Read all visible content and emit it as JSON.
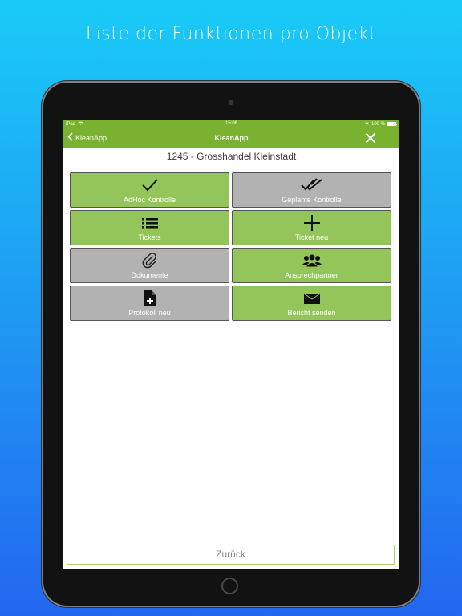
{
  "headline": "Liste der Funktionen pro Objekt",
  "status": {
    "device": "iPad",
    "time": "15:08",
    "battery": "100 %",
    "battery_level": 1.0
  },
  "nav": {
    "back_label": "KleanApp",
    "title": "KleanApp"
  },
  "object_title": "1245 - Grosshandel Kleinstadt",
  "tiles": [
    {
      "label": "AdHoc Kontrolle",
      "icon": "check-icon",
      "color": "#93c55a"
    },
    {
      "label": "Geplante Kontrolle",
      "icon": "double-check-icon",
      "color": "#b2b2b2"
    },
    {
      "label": "Tickets",
      "icon": "list-icon",
      "color": "#93c55a"
    },
    {
      "label": "Ticket neu",
      "icon": "plus-icon",
      "color": "#93c55a"
    },
    {
      "label": "Dokumente",
      "icon": "paperclip-icon",
      "color": "#b2b2b2"
    },
    {
      "label": "Ansprechpartner",
      "icon": "users-icon",
      "color": "#93c55a"
    },
    {
      "label": "Protokoll neu",
      "icon": "file-plus-icon",
      "color": "#b2b2b2"
    },
    {
      "label": "Bericht senden",
      "icon": "envelope-icon",
      "color": "#93c55a"
    }
  ],
  "footer": {
    "back_button_label": "Zurück"
  },
  "colors": {
    "accent": "#79b22e",
    "tile_green": "#93c55a",
    "tile_gray": "#b2b2b2"
  }
}
